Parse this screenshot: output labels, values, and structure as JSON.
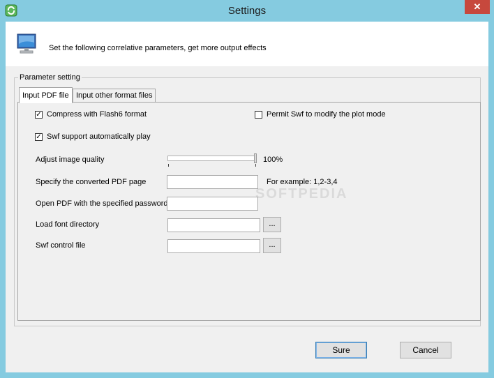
{
  "window": {
    "title": "Settings",
    "close_label": "✕",
    "colors": {
      "frame": "#85cbe0",
      "close": "#c7483d",
      "client": "#f0f0f0"
    }
  },
  "header": {
    "text": "Set the following correlative parameters, get more output effects",
    "icon": "monitor-icon"
  },
  "group": {
    "title": "Parameter setting"
  },
  "tabs": [
    {
      "label": "Input PDF file",
      "active": true
    },
    {
      "label": "Input other format files",
      "active": false
    }
  ],
  "options": {
    "compress": {
      "label": "Compress with Flash6 format",
      "checked": true
    },
    "permit": {
      "label": "Permit Swf to modify the plot mode",
      "checked": false
    },
    "autoplay": {
      "label": "Swf support automatically play",
      "checked": true
    }
  },
  "fields": {
    "quality": {
      "label": "Adjust image quality",
      "value_text": "100%",
      "value": 100
    },
    "pages": {
      "label": "Specify the converted PDF page",
      "value": "",
      "hint": "For example: 1,2-3,4"
    },
    "password": {
      "label": "Open PDF with the specified password",
      "value": ""
    },
    "font_dir": {
      "label": "Load font directory",
      "value": "",
      "browse": "..."
    },
    "control_file": {
      "label": "Swf control file",
      "value": "",
      "browse": "..."
    }
  },
  "buttons": {
    "ok": "Sure",
    "cancel": "Cancel"
  },
  "watermark": "SOFTPEDIA"
}
